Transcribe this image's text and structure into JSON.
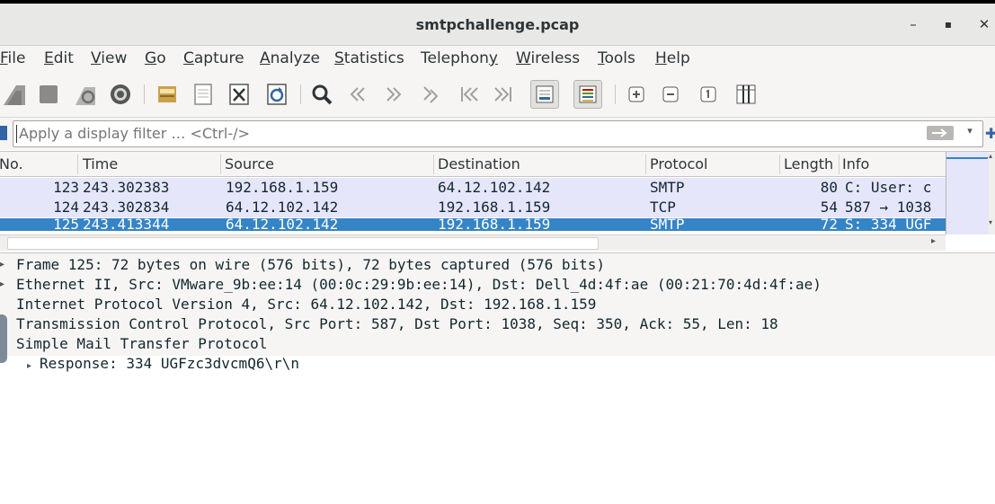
{
  "window": {
    "title": "smtpchallenge.pcap",
    "minimize_glyph": "–",
    "maximize_glyph": "▪",
    "close_glyph": "✕"
  },
  "menu": [
    {
      "pre": "",
      "u": "F",
      "post": "ile"
    },
    {
      "pre": "",
      "u": "E",
      "post": "dit"
    },
    {
      "pre": "",
      "u": "V",
      "post": "iew"
    },
    {
      "pre": "",
      "u": "G",
      "post": "o"
    },
    {
      "pre": "",
      "u": "C",
      "post": "apture"
    },
    {
      "pre": "",
      "u": "A",
      "post": "nalyze"
    },
    {
      "pre": "",
      "u": "S",
      "post": "tatistics"
    },
    {
      "pre": "Telephon",
      "u": "y",
      "post": ""
    },
    {
      "pre": "",
      "u": "W",
      "post": "ireless"
    },
    {
      "pre": "",
      "u": "T",
      "post": "ools"
    },
    {
      "pre": "",
      "u": "H",
      "post": "elp"
    }
  ],
  "toolbar": {
    "icons": [
      "shark-fin-icon",
      "stop-icon",
      "restart-capture-icon",
      "capture-options-icon",
      "open-file-icon",
      "save-file-icon",
      "close-file-icon",
      "reload-file-icon",
      "find-packet-icon",
      "go-back-icon",
      "go-forward-icon",
      "go-to-packet-icon",
      "go-first-icon",
      "go-last-icon",
      "autoscroll-icon",
      "colorize-icon",
      "zoom-in-icon",
      "zoom-out-icon",
      "normal-size-icon",
      "resize-columns-icon"
    ]
  },
  "filter": {
    "placeholder": "Apply a display filter … <Ctrl-/>"
  },
  "packet_list": {
    "columns": [
      "No.",
      "Time",
      "Source",
      "Destination",
      "Protocol",
      "Length",
      "Info"
    ],
    "rows": [
      {
        "no": "123",
        "time": "243.302383",
        "source": "192.168.1.159",
        "destination": "64.12.102.142",
        "protocol": "SMTP",
        "length": "80",
        "info": "C: User: c",
        "selected": false
      },
      {
        "no": "124",
        "time": "243.302834",
        "source": "64.12.102.142",
        "destination": "192.168.1.159",
        "protocol": "TCP",
        "length": "54",
        "info": "587 → 1038",
        "selected": false
      },
      {
        "no": "125",
        "time": "243.413344",
        "source": "64.12.102.142",
        "destination": "192.168.1.159",
        "protocol": "SMTP",
        "length": "72",
        "info": "S: 334 UGF",
        "selected": true
      }
    ]
  },
  "details": {
    "lines": [
      "Frame 125: 72 bytes on wire (576 bits), 72 bytes captured (576 bits)",
      "Ethernet II, Src: VMware_9b:ee:14 (00:0c:29:9b:ee:14), Dst: Dell_4d:4f:ae (00:21:70:4d:4f:ae)",
      "Internet Protocol Version 4, Src: 64.12.102.142, Dst: 192.168.1.159",
      "Transmission Control Protocol, Src Port: 587, Dst Port: 1038, Seq: 350, Ack: 55, Len: 18",
      "Simple Mail Transfer Protocol"
    ],
    "response": "Response: 334 UGFzc3dvcmQ6\\r\\n"
  },
  "colors": {
    "selected_row": "#3584c6",
    "smtp_row": "#e6e6fb",
    "chrome": "#f6f5f4"
  }
}
